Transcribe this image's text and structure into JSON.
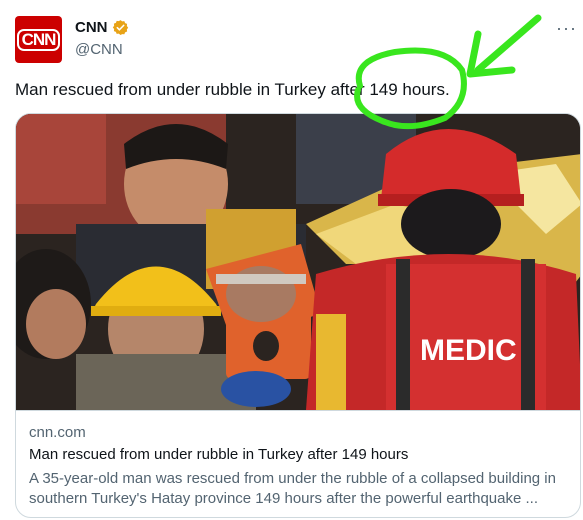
{
  "author": {
    "display_name": "CNN",
    "handle": "@CNN",
    "avatar_text": "CNN",
    "verified_icon": "verified-badge-icon",
    "brand_color": "#cc0000",
    "badge_color": "#e8a317"
  },
  "more_icon": "more-horizontal-icon",
  "tweet": {
    "text": "Man rescued from under rubble in Turkey after 149 hours."
  },
  "card": {
    "domain": "cnn.com",
    "title": "Man rescued from under rubble in Turkey after 149 hours",
    "description": "A 35-year-old man was rescued from under the rubble of a collapsed building in southern Turkey's Hatay province 149 hours after the powerful earthquake ...",
    "image": {
      "vest_text": "MEDIC"
    }
  },
  "annotation": {
    "color": "#39e61e",
    "shapes": [
      "circle",
      "arrow"
    ]
  }
}
